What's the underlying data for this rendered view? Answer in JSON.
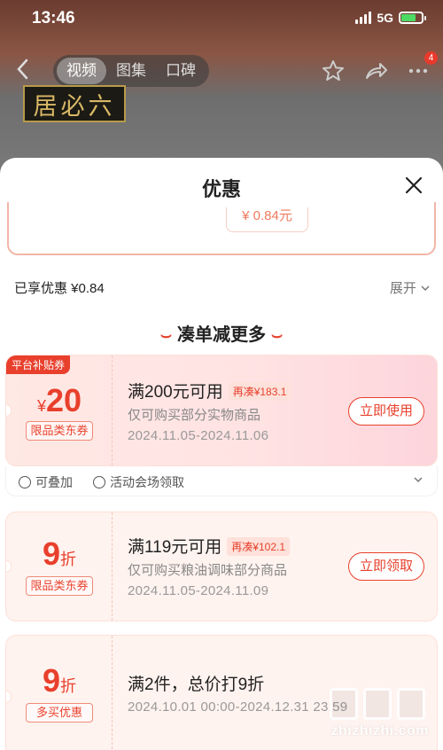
{
  "status_bar": {
    "time": "13:46",
    "network": "5G"
  },
  "nav": {
    "tabs": [
      "视频",
      "图集",
      "口碑"
    ],
    "active_tab": "视频",
    "badge_count": "4"
  },
  "brand": {
    "logo_text": "居必六"
  },
  "sheet": {
    "title": "优惠",
    "prev_price": "¥ 0.84元",
    "enjoyed_label": "已享优惠 ¥0.84",
    "expand_label": "展开",
    "section_title": "凑单减更多"
  },
  "coupons": [
    {
      "corner_tag": "平台补贴券",
      "currency": "¥",
      "amount": "20",
      "unit": "",
      "tag": "限品类东券",
      "condition": "满200元可用",
      "addon": "再凑¥183.1",
      "scope": "仅可购买部分实物商品",
      "date": "2024.11.05-2024.11.06",
      "action": "立即使用",
      "footer": {
        "stackable": "可叠加",
        "source": "活动会场领取"
      }
    },
    {
      "currency": "",
      "amount": "9",
      "unit": "折",
      "tag": "限品类东券",
      "condition": "满119元可用",
      "addon": "再凑¥102.1",
      "scope": "仅可购买粮油调味部分商品",
      "date": "2024.11.05-2024.11.09",
      "action": "立即领取"
    },
    {
      "currency": "",
      "amount": "9",
      "unit": "折",
      "tag": "多买优惠",
      "condition": "满2件，总价打9折",
      "date": "2024.10.01 00:00-2024.12.31 23:59"
    }
  ],
  "watermark": {
    "text": "zhizhizhi.com"
  },
  "colors": {
    "accent": "#e8402c",
    "coupon_bg": "#fff3ef"
  }
}
